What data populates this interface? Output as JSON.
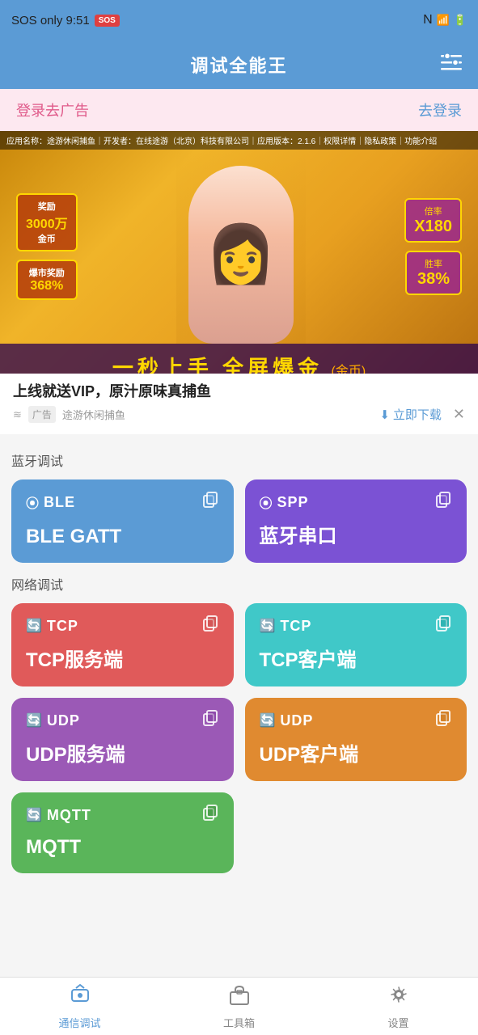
{
  "statusBar": {
    "carrier": "SOS only 9:51",
    "icons": [
      "NFC",
      "signal",
      "wifi",
      "battery"
    ]
  },
  "header": {
    "title": "调试全能王",
    "settingsLabel": "settings"
  },
  "adBanner": {
    "loginText": "登录去广告",
    "goLoginText": "去登录"
  },
  "advertisement": {
    "topBarText": "应用名称：途游休闲捕鱼｜开发者：在线途游（北京）科技有限公司｜应用版本：2.1.6｜权限详情｜隐私政策｜功能介绍",
    "title": "上线就送VIP，原汁原味真捕鱼",
    "adLabel": "广告",
    "source": "途游休闲捕鱼",
    "downloadText": "立即下载",
    "prize1": {
      "num": "3000万",
      "unit": "金币"
    },
    "prize2": {
      "label": "爆市奖励",
      "percent": "368%"
    },
    "rate1": {
      "label": "倍率",
      "num": "X180"
    },
    "rate2": {
      "label": "胜率",
      "num": "38%"
    },
    "bottomText": "一秒上手 全屏爆金",
    "bottomSub": "(金币)"
  },
  "sections": {
    "bluetooth": {
      "label": "蓝牙调试",
      "buttons": [
        {
          "id": "ble",
          "badge": "BLE",
          "name": "BLE GATT",
          "colorClass": "btn-ble"
        },
        {
          "id": "spp",
          "badge": "SPP",
          "name": "蓝牙串口",
          "colorClass": "btn-spp"
        }
      ]
    },
    "network": {
      "label": "网络调试",
      "buttons": [
        {
          "id": "tcp-server",
          "badge": "TCP",
          "name": "TCP服务端",
          "colorClass": "btn-tcp-server"
        },
        {
          "id": "tcp-client",
          "badge": "TCP",
          "name": "TCP客户端",
          "colorClass": "btn-tcp-client"
        },
        {
          "id": "udp-server",
          "badge": "UDP",
          "name": "UDP服务端",
          "colorClass": "btn-udp-server"
        },
        {
          "id": "udp-client",
          "badge": "UDP",
          "name": "UDP客户端",
          "colorClass": "btn-udp-client"
        },
        {
          "id": "mqtt",
          "badge": "MQTT",
          "name": "MQTT",
          "colorClass": "btn-mqtt"
        }
      ]
    }
  },
  "bottomNav": {
    "items": [
      {
        "id": "comm",
        "icon": "📡",
        "label": "通信调试",
        "active": true
      },
      {
        "id": "toolbox",
        "icon": "🧰",
        "label": "工具箱",
        "active": false
      },
      {
        "id": "settings",
        "icon": "⚙️",
        "label": "设置",
        "active": false
      }
    ]
  }
}
